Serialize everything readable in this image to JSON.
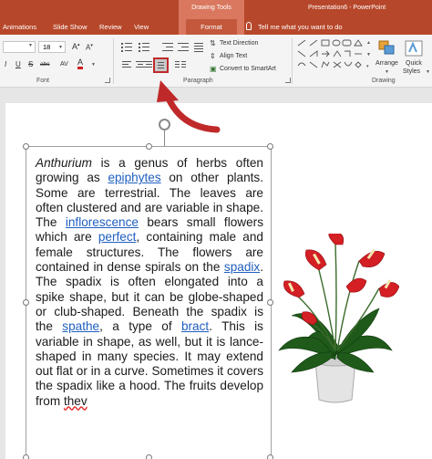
{
  "titlebar": {
    "tools_context": "Drawing Tools",
    "window_title": "Presentation6 - PowerPoint",
    "tabs": [
      "Animations",
      "Slide Show",
      "Review",
      "View"
    ],
    "active_tab": "Format",
    "tell_me": "Tell me what you want to do"
  },
  "ribbon": {
    "font_size": "18",
    "paragraph_buttons": {
      "text_direction": "Text Direction",
      "align_text": "Align Text",
      "convert_smartart": "Convert to SmartArt"
    },
    "drawing_buttons": {
      "arrange": "Arrange",
      "quick_styles_line1": "Quick",
      "quick_styles_line2": "Styles"
    },
    "group_labels": {
      "font": "Font",
      "paragraph": "Paragraph",
      "drawing": "Drawing"
    },
    "format_glyphs": {
      "italic": "I",
      "underline": "U",
      "strike": "S",
      "shadow": "abc",
      "font_color": "A"
    }
  },
  "slide": {
    "paragraph_parts": [
      {
        "text": "Anthurium",
        "style": "italic"
      },
      {
        "text": " is a genus of herbs often growing as ",
        "style": "plain"
      },
      {
        "text": "epiphytes",
        "style": "link"
      },
      {
        "text": " on other plants. Some are terrestrial. The leaves are often clustered and are variable in shape. The ",
        "style": "plain"
      },
      {
        "text": "inflorescence",
        "style": "link"
      },
      {
        "text": " bears small flowers which are ",
        "style": "plain"
      },
      {
        "text": "perfect",
        "style": "link"
      },
      {
        "text": ", containing male and female structures. The flowers are contained in dense spirals on the ",
        "style": "plain"
      },
      {
        "text": "spadix",
        "style": "link"
      },
      {
        "text": ". The spadix is often elongated into a spike shape, but it can be globe-shaped or club-shaped. Beneath the spadix is the ",
        "style": "plain"
      },
      {
        "text": "spathe",
        "style": "link"
      },
      {
        "text": ", a type of ",
        "style": "plain"
      },
      {
        "text": "bract",
        "style": "link"
      },
      {
        "text": ". This is variable in shape, as well, but it is lance-shaped in many species. It may extend out flat or in a curve. Sometimes it covers the spadix like a hood. The fruits develop from ",
        "style": "plain"
      },
      {
        "text": "thev",
        "style": "spellcheck"
      }
    ],
    "image_subject": "anthurium plant with red flowers in a white pot"
  },
  "colors": {
    "title_accent": "#b7472a",
    "context_tab": "#d9785f",
    "annotation_arrow": "#c0292a",
    "link": "#1f5fbf"
  }
}
